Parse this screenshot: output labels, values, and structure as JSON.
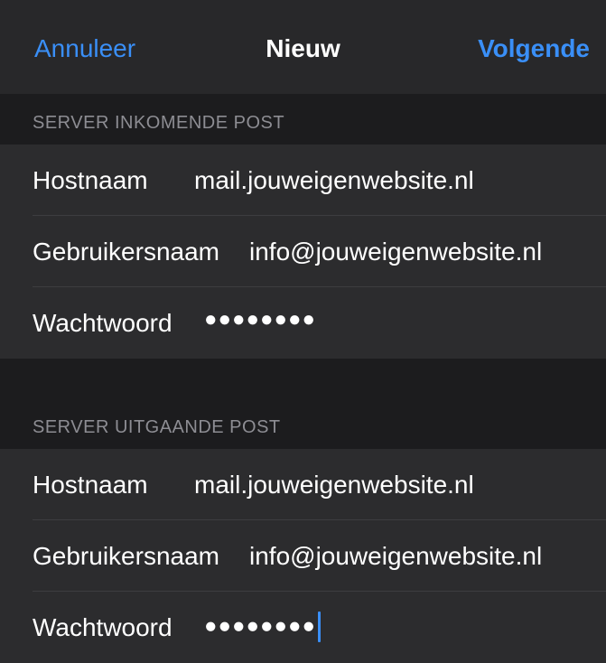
{
  "nav": {
    "cancel_label": "Annuleer",
    "title": "Nieuw",
    "next_label": "Volgende"
  },
  "incoming": {
    "header": "SERVER INKOMENDE POST",
    "hostname_label": "Hostnaam",
    "hostname_value": "mail.jouweigenwebsite.nl",
    "username_label": "Gebruikersnaam",
    "username_value": "info@jouweigenwebsite.nl",
    "password_label": "Wachtwoord",
    "password_value": "●●●●●●●●"
  },
  "outgoing": {
    "header": "SERVER UITGAANDE POST",
    "hostname_label": "Hostnaam",
    "hostname_value": "mail.jouweigenwebsite.nl",
    "username_label": "Gebruikersnaam",
    "username_value": "info@jouweigenwebsite.nl",
    "password_label": "Wachtwoord",
    "password_value": "●●●●●●●●"
  },
  "colors": {
    "accent": "#3a8ff7",
    "background": "#1c1c1e",
    "cell": "#2c2c2e",
    "secondary_text": "#8d8d93"
  }
}
